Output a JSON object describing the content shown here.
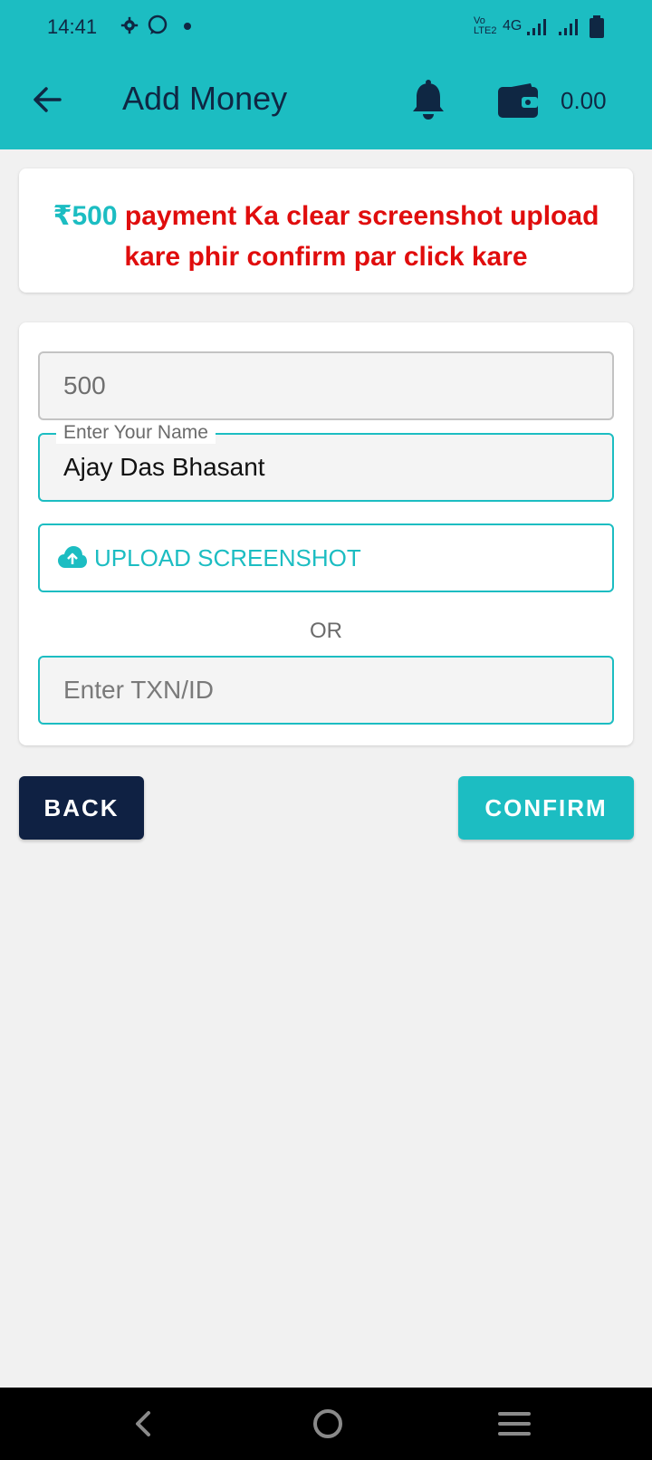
{
  "status_bar": {
    "time": "14:41",
    "network": "4G",
    "volte": "Vo LTE2"
  },
  "app_bar": {
    "title": "Add Money",
    "balance": "0.00",
    "icons": [
      "back-arrow-icon",
      "bell-icon",
      "wallet-icon"
    ]
  },
  "notice": {
    "amount": "₹500",
    "message": " payment Ka clear screenshot upload kare phir confirm par click kare"
  },
  "form": {
    "amount_value": "500",
    "name_label": "Enter Your Name",
    "name_value": "Ajay Das Bhasant",
    "upload_label": "UPLOAD SCREENSHOT",
    "or_text": "OR",
    "txn_placeholder": "Enter TXN/ID"
  },
  "actions": {
    "back_label": "BACK",
    "confirm_label": "CONFIRM"
  },
  "colors": {
    "primary": "#1cbdc2",
    "dark": "#0f2143",
    "alert": "#e00d0d"
  }
}
